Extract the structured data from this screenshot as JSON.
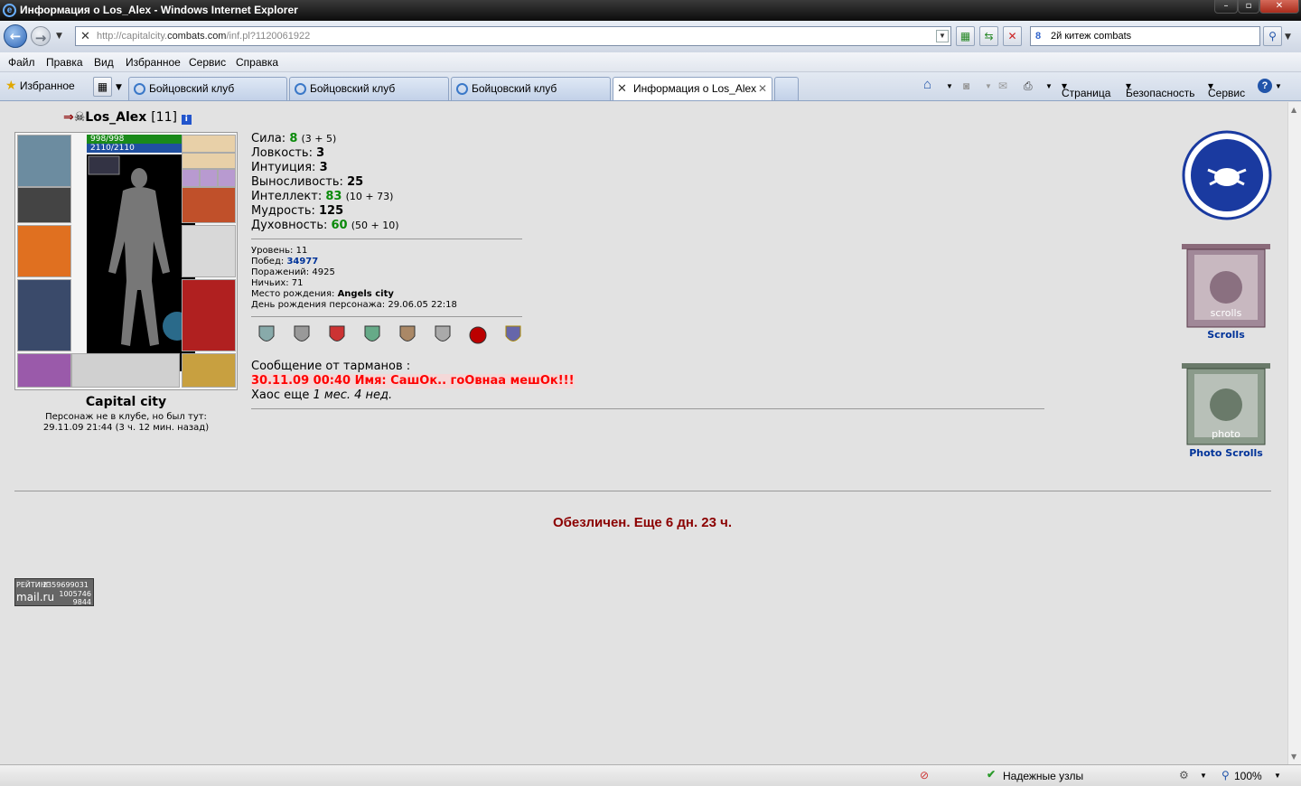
{
  "window": {
    "title": "Информация о Los_Alex - Windows Internet Explorer",
    "ie_logo": "e"
  },
  "address": {
    "url_prefix": "http://capitalcity.",
    "url_domain": "combats.com",
    "url_suffix": "/inf.pl?1120061922",
    "search_value": "2й китеж combats"
  },
  "menu": [
    "Файл",
    "Правка",
    "Вид",
    "Избранное",
    "Сервис",
    "Справка"
  ],
  "favorites_label": "Избранное",
  "tabs": [
    {
      "label": "Бойцовский клуб",
      "active": false
    },
    {
      "label": "Бойцовский клуб",
      "active": false
    },
    {
      "label": "Бойцовский клуб",
      "active": false
    },
    {
      "label": "Информация о Los_Alex",
      "active": true
    }
  ],
  "commandbar": {
    "page": "Страница",
    "security": "Безопасность",
    "tools": "Сервис"
  },
  "character": {
    "name": "Los_Alex",
    "level": "[11]",
    "hp": "998/998",
    "mana": "2110/2110",
    "city": "Capital city",
    "club_line1": "Персонаж не в клубе, но был тут:",
    "club_line2": "29.11.09 21:44 (3 ч. 12 мин. назад)"
  },
  "stats": [
    {
      "label": "Сила:",
      "value": "8",
      "extra": "(3 + 5)",
      "green": true
    },
    {
      "label": "Ловкость:",
      "value": "3",
      "extra": "",
      "green": false
    },
    {
      "label": "Интуиция:",
      "value": "3",
      "extra": "",
      "green": false
    },
    {
      "label": "Выносливость:",
      "value": "25",
      "extra": "",
      "green": false
    },
    {
      "label": "Интеллект:",
      "value": "83",
      "extra": "(10 + 73)",
      "green": true
    },
    {
      "label": "Мудрость:",
      "value": "125",
      "extra": "",
      "green": false
    },
    {
      "label": "Духовность:",
      "value": "60",
      "extra": "(50 + 10)",
      "green": true
    }
  ],
  "info": {
    "level_label": "Уровень:",
    "level_value": "11",
    "wins_label": "Побед:",
    "wins_value": "34977",
    "losses_label": "Поражений:",
    "losses_value": "4925",
    "draws_label": "Ничьих:",
    "draws_value": "71",
    "birthplace_label": "Место рождения:",
    "birthplace_value": "Angels city",
    "birthday_label": "День рождения персонажа:",
    "birthday_value": "29.06.05 22:18"
  },
  "message": {
    "header": "Сообщение от тарманов :",
    "line": "30.11.09 00:40 Имя: СашОк.. гоОвнаа мешОк!!!",
    "chaos_label": "Хаос еще",
    "chaos_value": "1 мес. 4 нед."
  },
  "obezlichen": "Обезличен. Еще 6 дн. 23 ч.",
  "right_links": {
    "scrolls": "Scrolls",
    "photo_scrolls": "Photo Scrolls",
    "scroll_text": "scrolls",
    "photo_text": "photo"
  },
  "rating": {
    "line1": "РЕЙТИНГ",
    "n1": "2359699031",
    "logo": "mail.ru",
    "n2": "1005746",
    "n3": "9844"
  },
  "status": {
    "trusted": "Надежные узлы",
    "zoom": "100%"
  },
  "colors": {
    "stat_green": "#0a8a0a",
    "alert_red": "#ff0000",
    "obez": "#8b0000",
    "link_blue": "#003399"
  }
}
